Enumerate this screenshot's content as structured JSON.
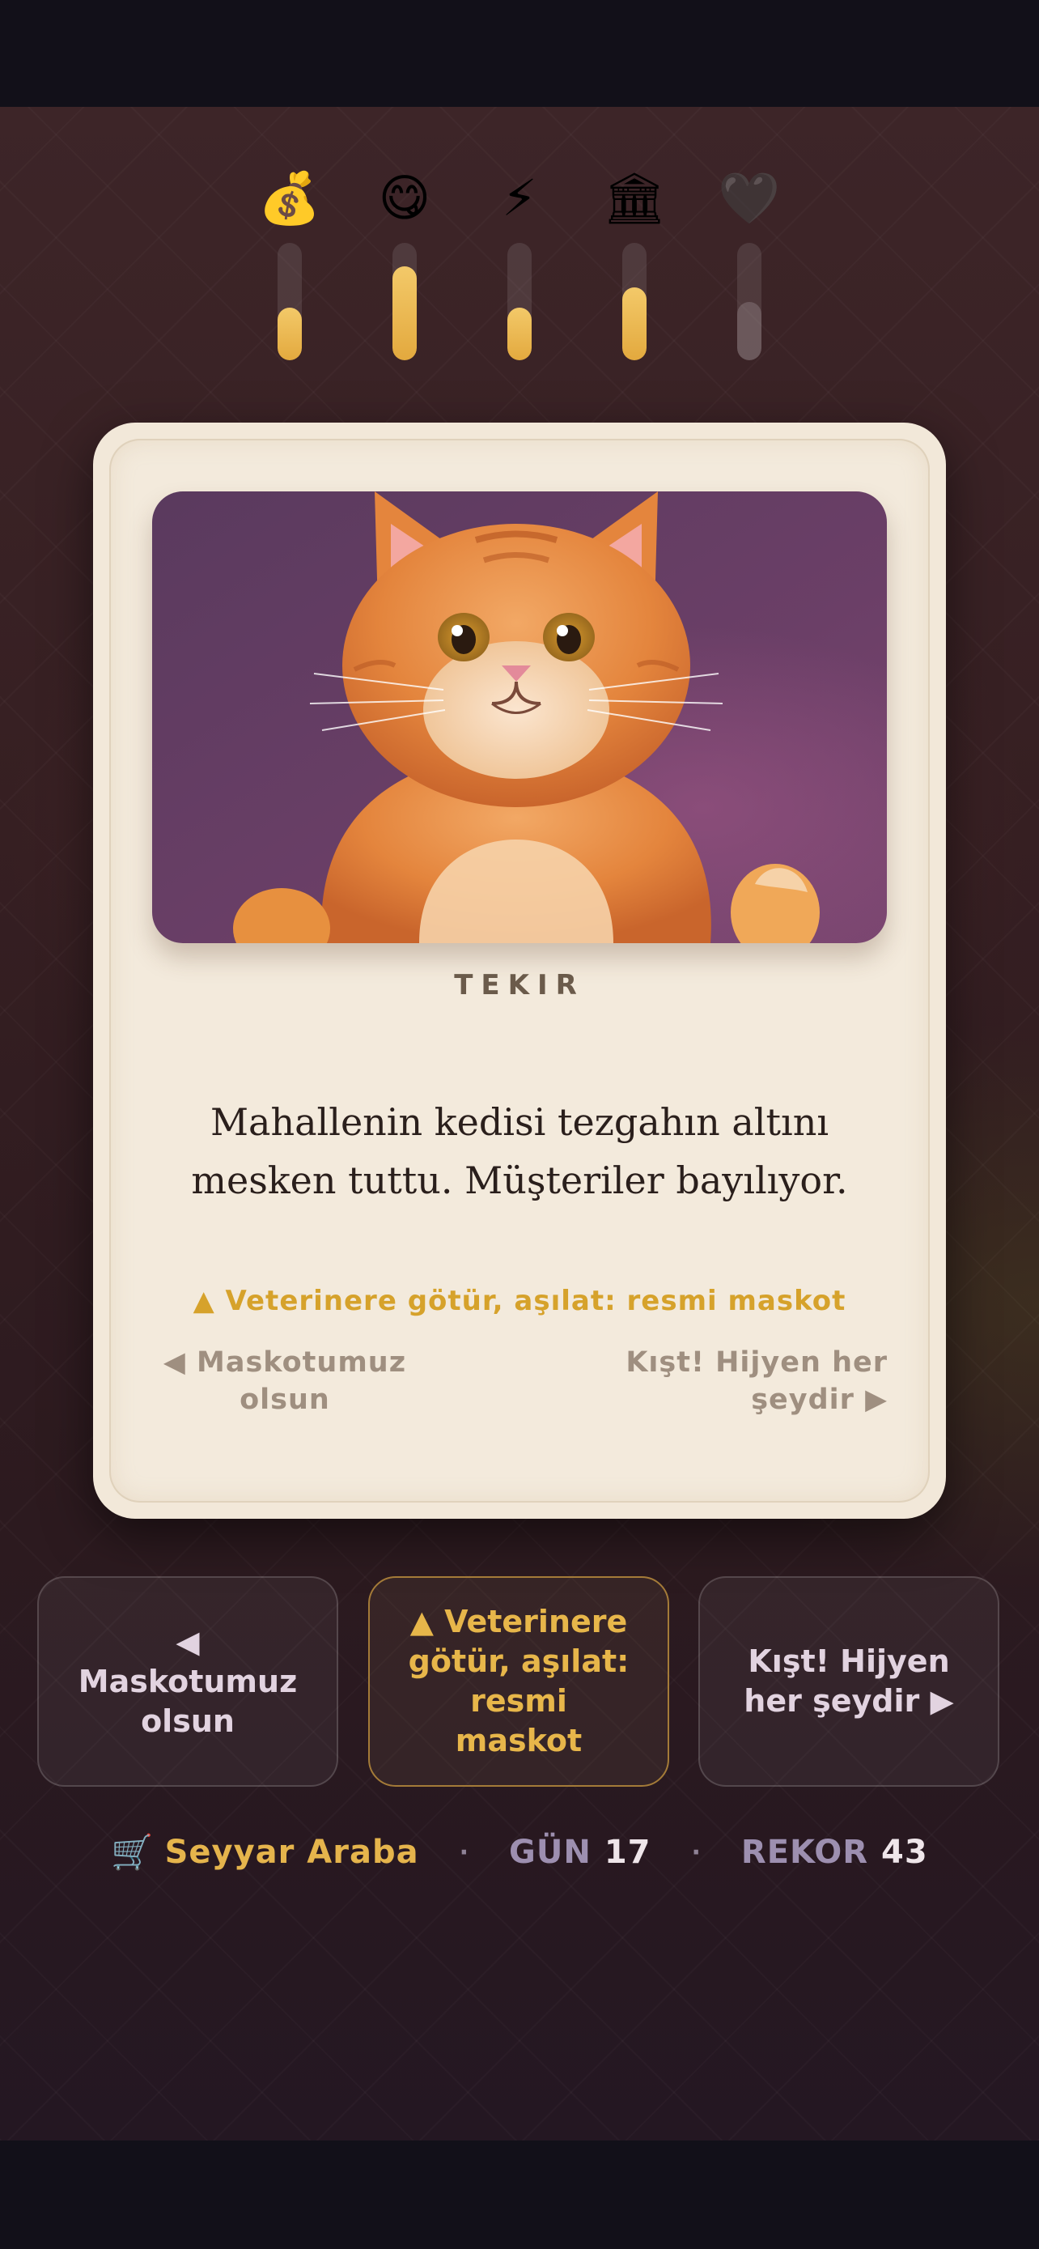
{
  "stats": [
    {
      "icon": "money-bag-icon",
      "glyph": "💰",
      "level": 0.45
    },
    {
      "icon": "yum-face-icon",
      "glyph": "😋",
      "level": 0.8
    },
    {
      "icon": "lightning-icon",
      "glyph": "⚡",
      "level": 0.45
    },
    {
      "icon": "bank-icon",
      "glyph": "🏛",
      "level": 0.62
    },
    {
      "icon": "black-heart-icon",
      "glyph": "🖤",
      "level": 0.5
    }
  ],
  "card": {
    "character": "TEKIR",
    "story": "Mahallenin kedisi tezgahın altını mesken tuttu. Müşteriler bayılıyor.",
    "hint_up": "▲ Veterinere götür, aşılat: resmi maskot",
    "hint_left": "◀ Maskotumuz olsun",
    "hint_right": "Kışt! Hijyen her şeydir ▶"
  },
  "choices": {
    "left": "◀ Maskotumuz olsun",
    "up": "▲ Veterinere götür, aşılat: resmi maskot",
    "right": "Kışt! Hijyen her şeydir ▶"
  },
  "footer": {
    "cart_icon": "🛒",
    "business": "Seyyar Araba",
    "separator": "·",
    "day_label": "GÜN",
    "day_value": "17",
    "record_label": "REKOR",
    "record_value": "43"
  },
  "colors": {
    "accent": "#e5b44c",
    "card_bg": "#f2e8d9",
    "background": "#3a2326",
    "bar_fill": "#ecbb52"
  }
}
